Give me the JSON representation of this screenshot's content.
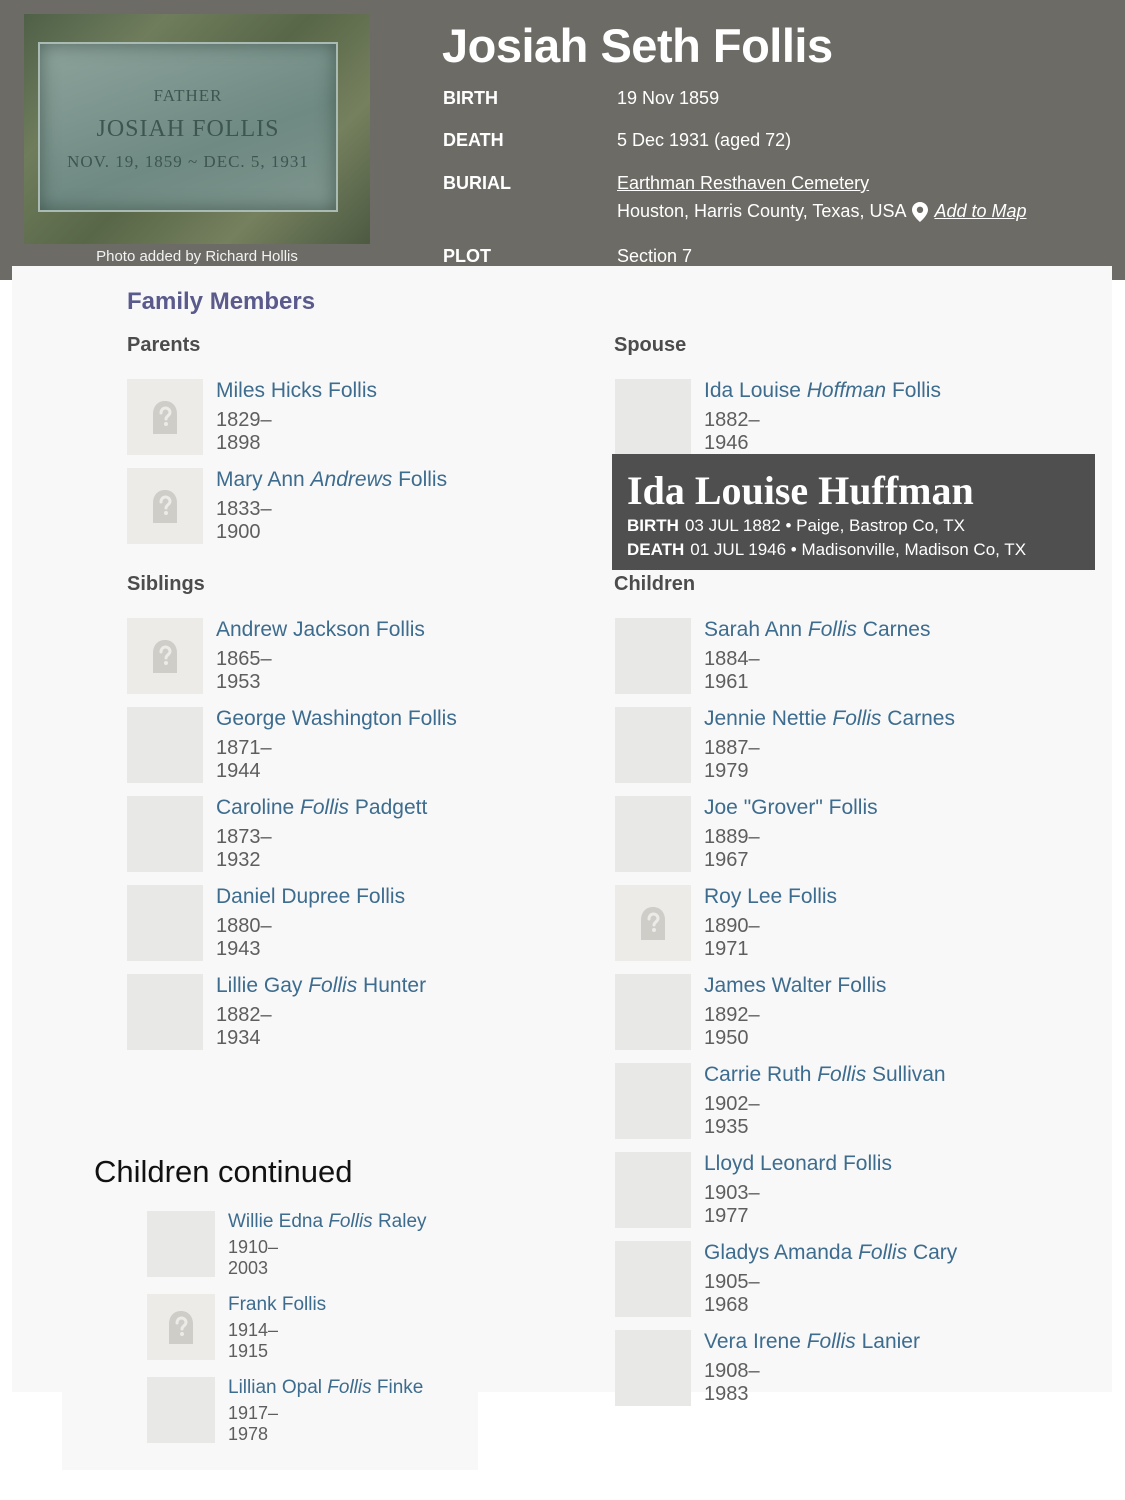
{
  "header": {
    "name": "Josiah Seth Follis",
    "photo": {
      "plaque_lines": [
        "FATHER",
        "JOSIAH FOLLIS",
        "NOV. 19, 1859 ~ DEC. 5, 1931"
      ],
      "credit": "Photo added by Richard Hollis"
    },
    "facts": {
      "birth_label": "BIRTH",
      "birth_value": "19 Nov 1859",
      "death_label": "DEATH",
      "death_value": "5 Dec 1931 (aged 72)",
      "burial_label": "BURIAL",
      "burial_cemetery": "Earthman Resthaven Cemetery",
      "burial_place": "Houston, Harris County, Texas, USA",
      "add_to_map": "Add to Map",
      "plot_label": "PLOT",
      "plot_value": "Section 7"
    }
  },
  "family": {
    "title": "Family Members",
    "parents_heading": "Parents",
    "spouse_heading": "Spouse",
    "siblings_heading": "Siblings",
    "children_heading": "Children",
    "parents": [
      {
        "name_pre": "Miles Hicks Follis",
        "name_maiden": "",
        "name_post": "",
        "dates": "1829–1898",
        "photo": "placeholder"
      },
      {
        "name_pre": "Mary Ann ",
        "name_maiden": "Andrews",
        "name_post": " Follis",
        "dates": "1833–1900",
        "photo": "placeholder"
      }
    ],
    "spouse": [
      {
        "name_pre": "Ida Louise ",
        "name_maiden": "Hoffman",
        "name_post": " Follis",
        "dates": "1882–1946",
        "photo": "stone-green"
      }
    ],
    "siblings": [
      {
        "name_pre": "Andrew Jackson Follis",
        "name_maiden": "",
        "name_post": "",
        "dates": "1865–1953",
        "photo": "placeholder"
      },
      {
        "name_pre": "George Washington Follis",
        "name_maiden": "",
        "name_post": "",
        "dates": "1871–1944",
        "photo": "stone-grey"
      },
      {
        "name_pre": "Caroline ",
        "name_maiden": "Follis",
        "name_post": " Padgett",
        "dates": "1873–1932",
        "photo": "stone-green"
      },
      {
        "name_pre": "Daniel Dupree Follis",
        "name_maiden": "",
        "name_post": "",
        "dates": "1880–1943",
        "photo": "stone-dark"
      },
      {
        "name_pre": "Lillie Gay ",
        "name_maiden": "Follis",
        "name_post": " Hunter",
        "dates": "1882–1934",
        "photo": "stone-tan"
      }
    ],
    "children": [
      {
        "name_pre": "Sarah Ann ",
        "name_maiden": "Follis",
        "name_post": " Carnes",
        "dates": "1884–1961",
        "photo": "moss"
      },
      {
        "name_pre": "Jennie Nettie ",
        "name_maiden": "Follis",
        "name_post": " Carnes",
        "dates": "1887–1979",
        "photo": "grass"
      },
      {
        "name_pre": "Joe \"Grover\" Follis",
        "name_maiden": "",
        "name_post": "",
        "dates": "1889–1967",
        "photo": "follis"
      },
      {
        "name_pre": "Roy Lee Follis",
        "name_maiden": "",
        "name_post": "",
        "dates": "1890–1971",
        "photo": "placeholder"
      },
      {
        "name_pre": "James Walter Follis",
        "name_maiden": "",
        "name_post": "",
        "dates": "1892–1950",
        "photo": "granite"
      },
      {
        "name_pre": "Carrie Ruth ",
        "name_maiden": "Follis",
        "name_post": " Sullivan",
        "dates": "1902–1935",
        "photo": "blue"
      },
      {
        "name_pre": "Lloyd Leonard Follis",
        "name_maiden": "",
        "name_post": "",
        "dates": "1903–1977",
        "photo": "ground"
      },
      {
        "name_pre": "Gladys Amanda ",
        "name_maiden": "Follis",
        "name_post": " Cary",
        "dates": "1905–1968",
        "photo": "slate"
      },
      {
        "name_pre": "Vera Irene ",
        "name_maiden": "Follis",
        "name_post": " Lanier",
        "dates": "1908–1983",
        "photo": "light"
      }
    ]
  },
  "tooltip": {
    "name": "Ida Louise Huffman",
    "birth_label": "BIRTH",
    "birth_value": "03 JUL 1882 • Paige, Bastrop Co, TX",
    "death_label": "DEATH",
    "death_value": "01 JUL 1946 • Madisonville, Madison Co, TX"
  },
  "continued": {
    "heading": "Children continued",
    "children": [
      {
        "name_pre": "Willie Edna ",
        "name_maiden": "Follis",
        "name_post": " Raley",
        "dates": "1910–2003",
        "photo": "road"
      },
      {
        "name_pre": "Frank Follis",
        "name_maiden": "",
        "name_post": "",
        "dates": "1914–1915",
        "photo": "placeholder"
      },
      {
        "name_pre": "Lillian Opal ",
        "name_maiden": "Follis",
        "name_post": " Finke",
        "dates": "1917–1978",
        "photo": "flowers"
      }
    ]
  },
  "colors": {
    "header_bg": "#6c6b66",
    "panel_bg": "#f8f8f8",
    "link": "#3d6c8e",
    "section_title": "#5a5a8c",
    "tooltip_bg": "#4f4f4f"
  }
}
